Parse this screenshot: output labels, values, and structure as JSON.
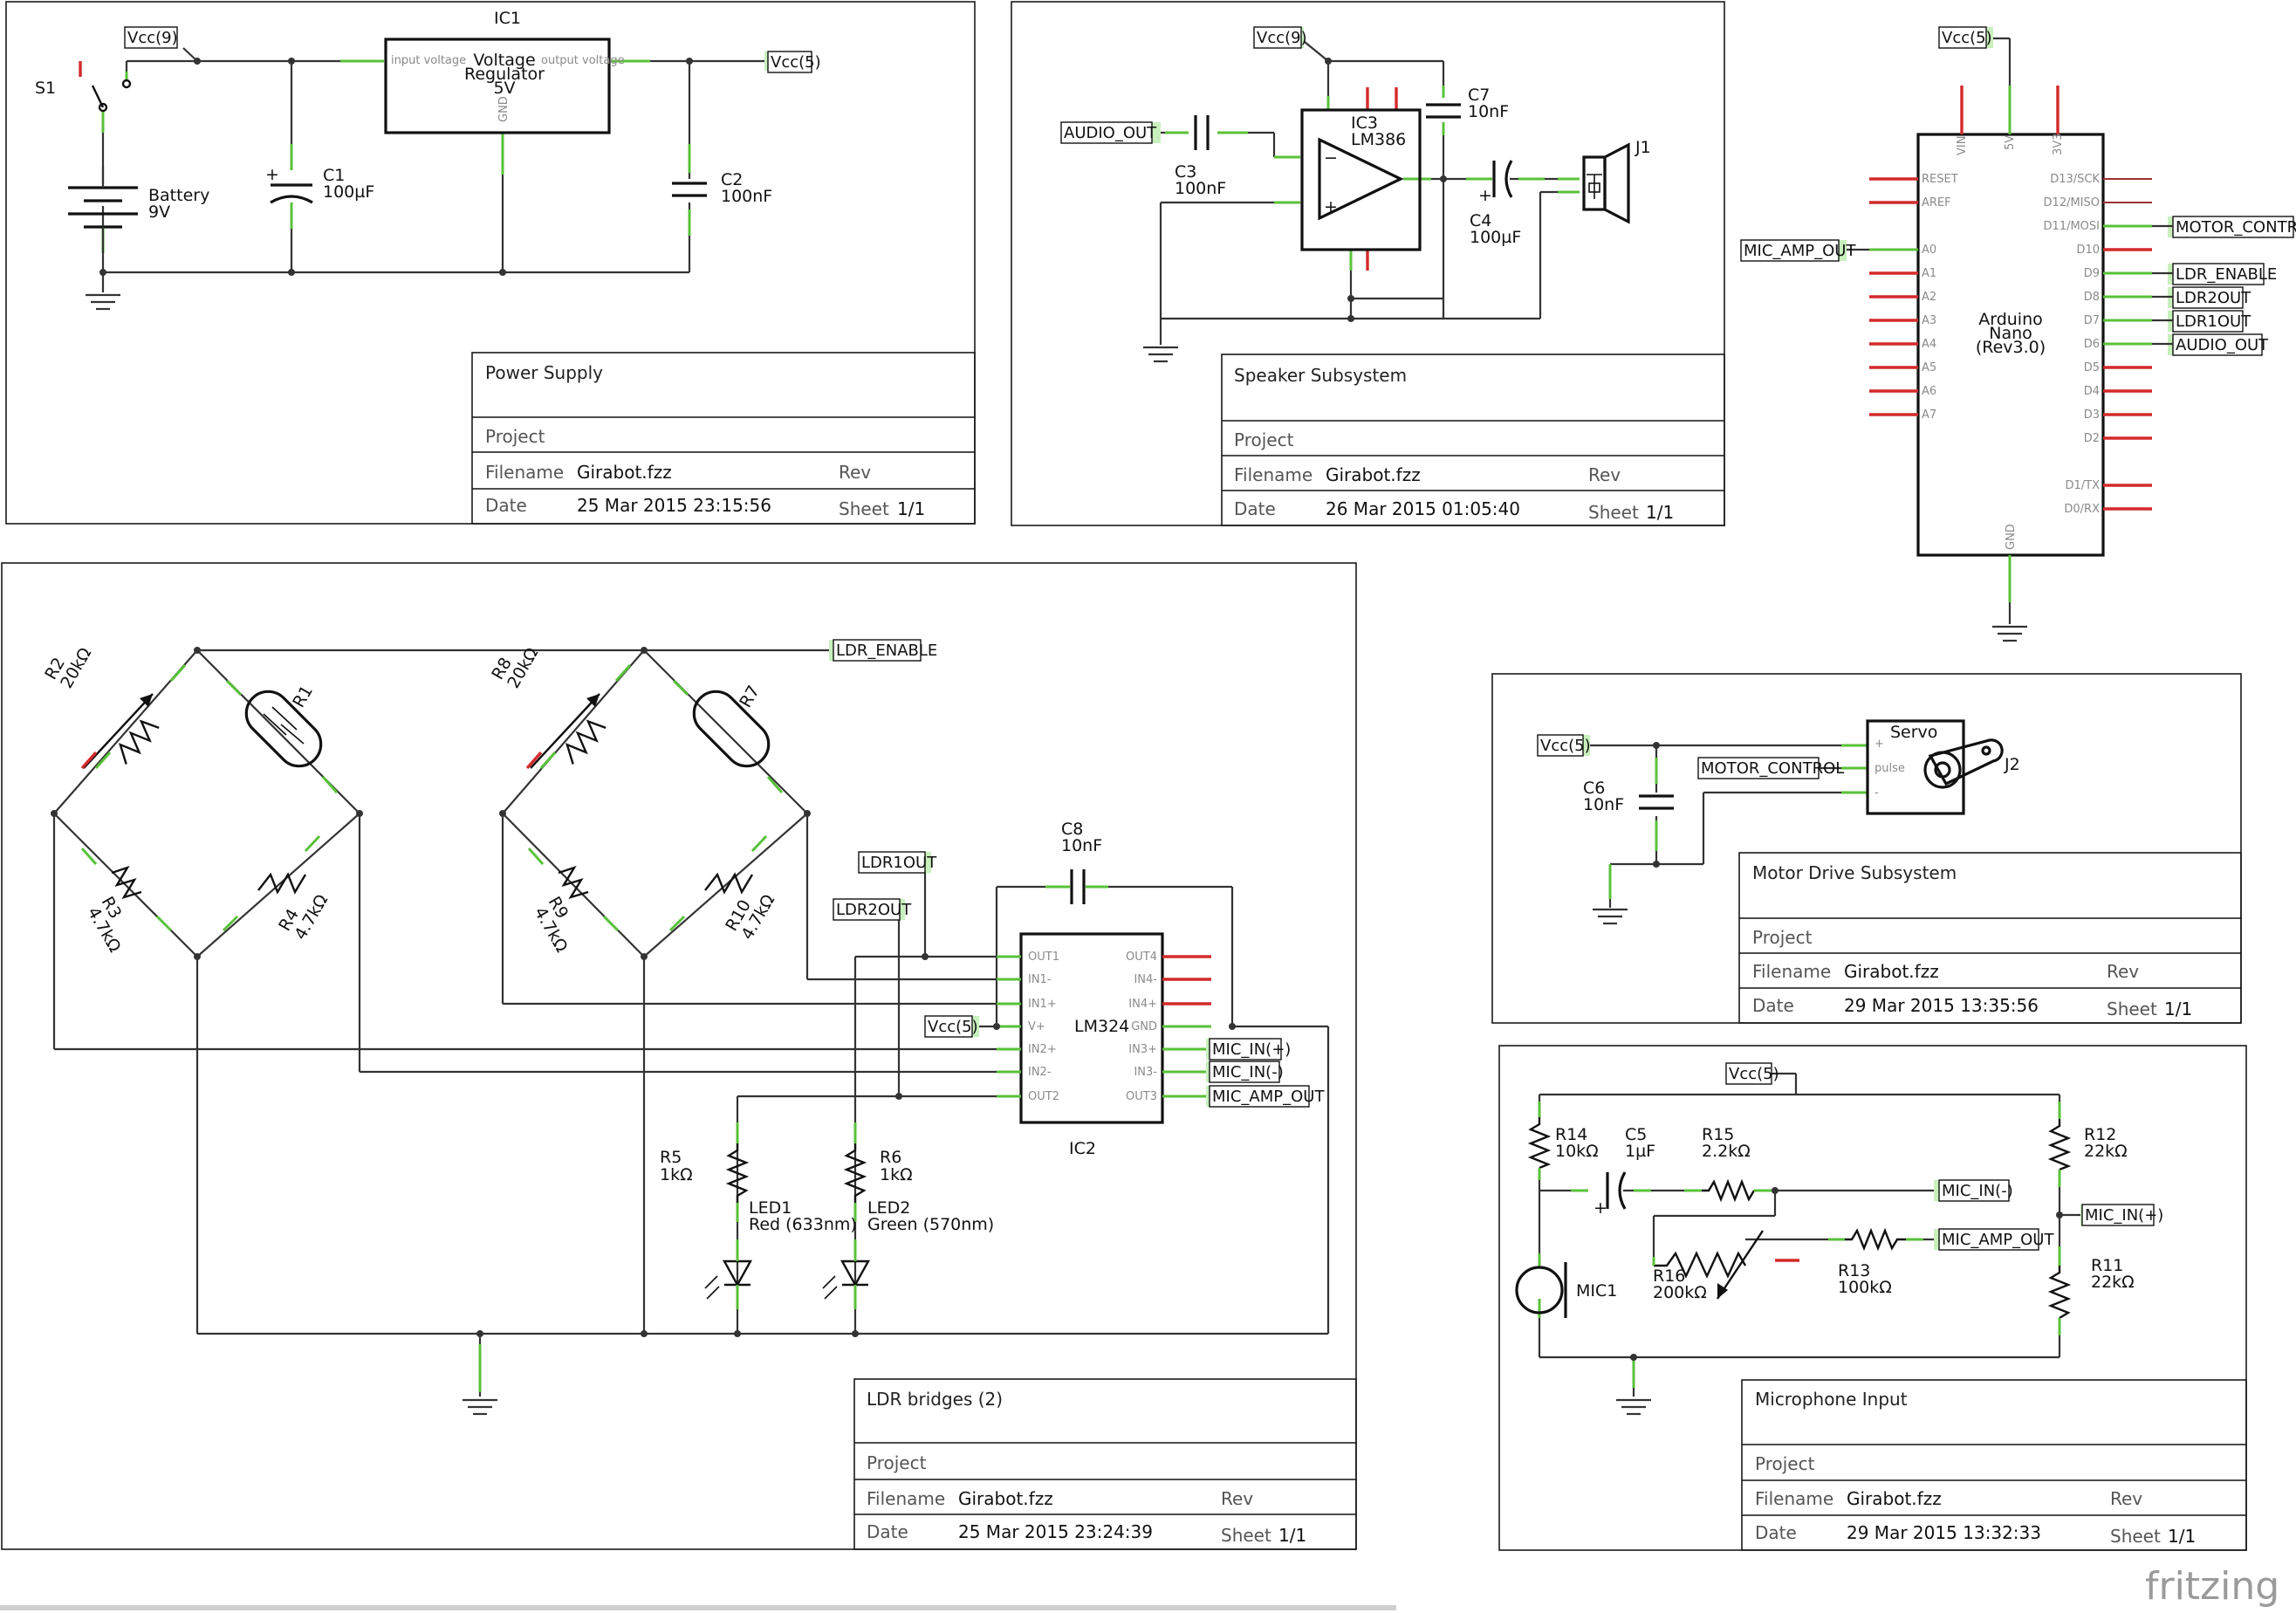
{
  "title_blocks": {
    "power": {
      "title": "Power Supply",
      "project_label": "Project",
      "filename_label": "Filename",
      "filename": "Girabot.fzz",
      "rev_label": "Rev",
      "date_label": "Date",
      "date": "25 Mar 2015 23:15:56",
      "sheet_label": "Sheet",
      "sheet": "1/1"
    },
    "speaker": {
      "title": "Speaker Subsystem",
      "project_label": "Project",
      "filename_label": "Filename",
      "filename": "Girabot.fzz",
      "rev_label": "Rev",
      "date_label": "Date",
      "date": "26 Mar 2015 01:05:40",
      "sheet_label": "Sheet",
      "sheet": "1/1"
    },
    "ldr": {
      "title": "LDR bridges (2)",
      "project_label": "Project",
      "filename_label": "Filename",
      "filename": "Girabot.fzz",
      "rev_label": "Rev",
      "date_label": "Date",
      "date": "25 Mar 2015 23:24:39",
      "sheet_label": "Sheet",
      "sheet": "1/1"
    },
    "motor": {
      "title": "Motor Drive Subsystem",
      "project_label": "Project",
      "filename_label": "Filename",
      "filename": "Girabot.fzz",
      "rev_label": "Rev",
      "date_label": "Date",
      "date": "29 Mar 2015 13:35:56",
      "sheet_label": "Sheet",
      "sheet": "1/1"
    },
    "mic": {
      "title": "Microphone Input",
      "project_label": "Project",
      "filename_label": "Filename",
      "filename": "Girabot.fzz",
      "rev_label": "Rev",
      "date_label": "Date",
      "date": "29 Mar 2015 13:32:33",
      "sheet_label": "Sheet",
      "sheet": "1/1"
    }
  },
  "nets": {
    "vcc9": "Vcc(9)",
    "vcc5": "Vcc(5)",
    "audio_out": "AUDIO_OUT",
    "mic_amp_out": "MIC_AMP_OUT",
    "motor_control": "MOTOR_CONTROL",
    "ldr_enable": "LDR_ENABLE",
    "ldr2out": "LDR2OUT",
    "ldr1out": "LDR1OUT",
    "mic_in_pos": "MIC_IN(+)",
    "mic_in_neg": "MIC_IN(-)"
  },
  "power": {
    "ic1": "IC1",
    "ic1_body": [
      "Voltage",
      "Regulator",
      "5V"
    ],
    "pin_in": "input voltage",
    "pin_out": "output voltage",
    "pin_gnd": "GND",
    "s1": "S1",
    "battery": "Battery",
    "battery_v": "9V",
    "c1": "C1",
    "c1_val": "100µF",
    "c2": "C2",
    "c2_val": "100nF"
  },
  "speaker": {
    "ic3": "IC3",
    "ic3_val": "LM386",
    "c3": "C3",
    "c3_val": "100nF",
    "c7": "C7",
    "c7_val": "10nF",
    "c4": "C4",
    "c4_val": "100µF",
    "j1": "J1"
  },
  "arduino": {
    "name": [
      "Arduino",
      "Nano",
      "(Rev3.0)"
    ],
    "top_pins": [
      "VIN",
      "5V",
      "3V3"
    ],
    "left_pins": [
      "RESET",
      "AREF",
      "A0",
      "A1",
      "A2",
      "A3",
      "A4",
      "A5",
      "A6",
      "A7"
    ],
    "right_pins": [
      "D13/SCK",
      "D12/MISO",
      "D11/MOSI",
      "D10",
      "D9",
      "D8",
      "D7",
      "D6",
      "D5",
      "D4",
      "D3",
      "D2",
      "D1/TX",
      "D0/RX"
    ],
    "gnd": "GND"
  },
  "ldr": {
    "r1": "R1",
    "r2": "R2",
    "r2_val": "20kΩ",
    "r3": "R3",
    "r3_val": "4.7kΩ",
    "r4": "R4",
    "r4_val": "4.7kΩ",
    "r7": "R7",
    "r8": "R8",
    "r8_val": "20kΩ",
    "r9": "R9",
    "r9_val": "4.7kΩ",
    "r10": "R10",
    "r10_val": "4.7kΩ",
    "r5": "R5",
    "r5_val": "1kΩ",
    "r6": "R6",
    "r6_val": "1kΩ",
    "led1": "LED1",
    "led1_val": "Red (633nm)",
    "led2": "LED2",
    "led2_val": "Green (570nm)",
    "c8": "C8",
    "c8_val": "10nF",
    "ic2": "IC2",
    "ic2_val": "LM324",
    "ic2_left": [
      "OUT1",
      "IN1-",
      "IN1+",
      "V+",
      "IN2+",
      "IN2-",
      "OUT2"
    ],
    "ic2_right": [
      "OUT4",
      "IN4-",
      "IN4+",
      "GND",
      "IN3+",
      "IN3-",
      "OUT3"
    ]
  },
  "motor": {
    "servo": "Servo",
    "j2": "J2",
    "pulse": "pulse",
    "c6": "C6",
    "c6_val": "10nF"
  },
  "mic": {
    "r14": "R14",
    "r14_val": "10kΩ",
    "c5": "C5",
    "c5_val": "1µF",
    "r15": "R15",
    "r15_val": "2.2kΩ",
    "r12": "R12",
    "r12_val": "22kΩ",
    "r16": "R16",
    "r16_val": "200kΩ",
    "r13": "R13",
    "r13_val": "100kΩ",
    "r11": "R11",
    "r11_val": "22kΩ",
    "mic1": "MIC1"
  },
  "branding": {
    "logo": "fritzing"
  }
}
